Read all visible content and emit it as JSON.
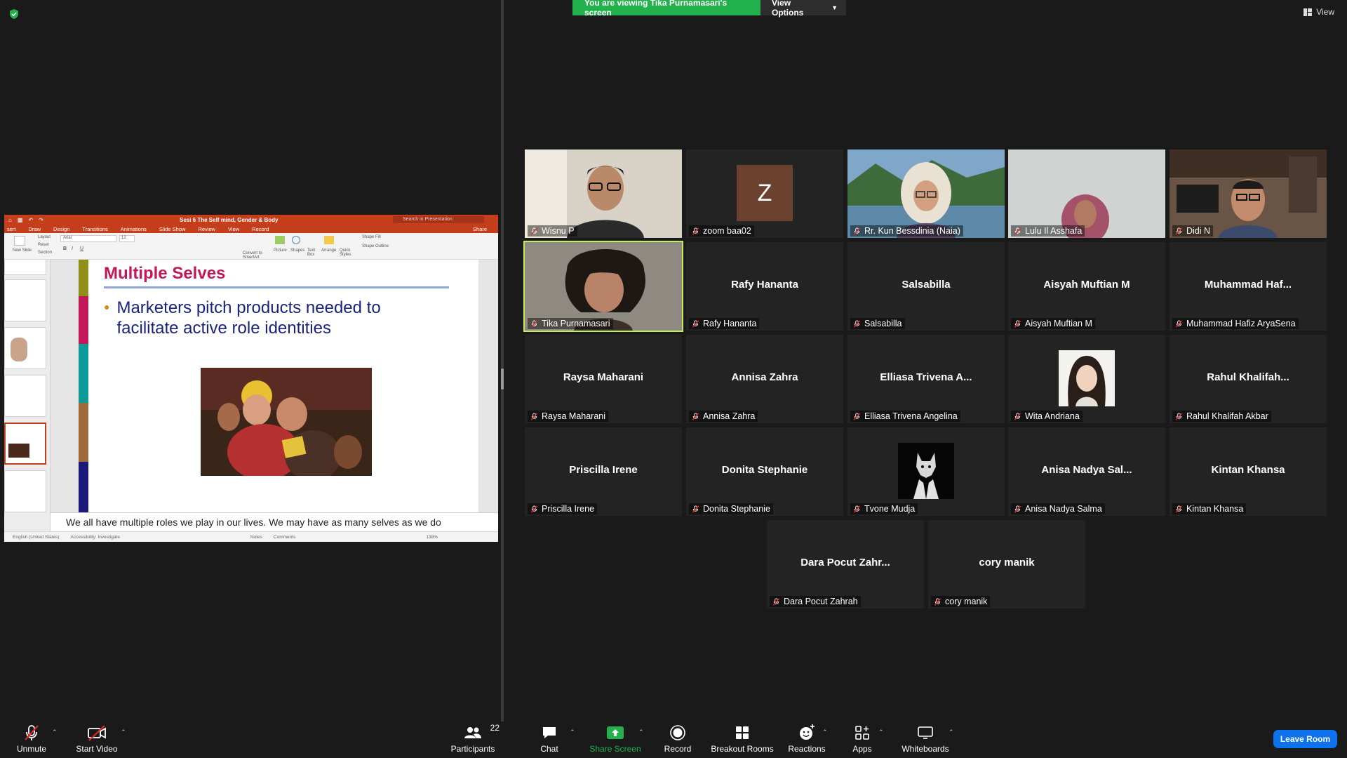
{
  "banner": {
    "viewing_text": "You are viewing Tika Purnamasari's screen",
    "view_options_label": "View Options"
  },
  "view_button_label": "View",
  "colors": {
    "banner_green": "#23b14d",
    "speaker_outline": "#c2ee5a",
    "leave_blue": "#0e72ed",
    "muted_red": "#e02828",
    "share_screen_green": "#23b14d",
    "powerpoint_red": "#c43e1c"
  },
  "presentation": {
    "doc_title": "Sesi 6 The Self mind, Gender & Body",
    "search_placeholder": "Search in Presentation",
    "tabs": [
      "sert",
      "Draw",
      "Design",
      "Transitions",
      "Animations",
      "Slide Show",
      "Review",
      "View",
      "Record"
    ],
    "share_label": "Share",
    "ribbon": {
      "new_slide": "New Slide",
      "layout": "Layout",
      "reset": "Reset",
      "section": "Section",
      "font": "Arial",
      "font_size": "12",
      "convert_smartart": "Convert to SmartArt",
      "picture": "Picture",
      "shapes": "Shapes",
      "text_box": "Text Box",
      "arrange": "Arrange",
      "quick_styles": "Quick Styles",
      "shape_fill": "Shape Fill",
      "shape_outline": "Shape Outline"
    },
    "slide": {
      "title": "Multiple Selves",
      "bullet": "Marketers pitch products needed to facilitate active role identities"
    },
    "notes_text": "We all have multiple roles we play in our lives. We may have as many selves as we do",
    "status": {
      "language": "English (United States)",
      "accessibility": "Accessibility: Investigate",
      "notes": "Notes",
      "comments": "Comments",
      "zoom": "138%"
    }
  },
  "participants": [
    {
      "name": "Wisnu P",
      "display": "",
      "type": "video"
    },
    {
      "name": "zoom baa02",
      "display": "",
      "type": "letter",
      "letter": "Z"
    },
    {
      "name": "Rr. Kun Bessdinia (Naia)",
      "display": "",
      "type": "video"
    },
    {
      "name": "Lulu Il Asshafa",
      "display": "",
      "type": "video"
    },
    {
      "name": "Didi N",
      "display": "",
      "type": "video"
    },
    {
      "name": "Tika Purnamasari",
      "display": "",
      "type": "video",
      "speaker": true
    },
    {
      "name": "Rafy Hananta",
      "display": "Rafy Hananta",
      "type": "name"
    },
    {
      "name": "Salsabilla",
      "display": "Salsabilla",
      "type": "name"
    },
    {
      "name": "Aisyah Muftian M",
      "display": "Aisyah Muftian M",
      "type": "name"
    },
    {
      "name": "Muhammad Hafiz AryaSena",
      "display": "Muhammad  Haf...",
      "type": "name"
    },
    {
      "name": "Raysa Maharani",
      "display": "Raysa Maharani",
      "type": "name"
    },
    {
      "name": "Annisa Zahra",
      "display": "Annisa Zahra",
      "type": "name"
    },
    {
      "name": "Elliasa Trivena Angelina",
      "display": "Elliasa  Trivena  A...",
      "type": "name"
    },
    {
      "name": "Wita Andriana",
      "display": "",
      "type": "photo"
    },
    {
      "name": "Rahul Khalifah Akbar",
      "display": "Rahul  Khalifah...",
      "type": "name"
    },
    {
      "name": "Priscilla Irene",
      "display": "Priscilla Irene",
      "type": "name"
    },
    {
      "name": "Donita Stephanie",
      "display": "Donita Stephanie",
      "type": "name"
    },
    {
      "name": "Tvone Mudja",
      "display": "",
      "type": "wolf"
    },
    {
      "name": "Anisa Nadya Salma",
      "display": "Anisa  Nadya  Sal...",
      "type": "name"
    },
    {
      "name": "Kintan Khansa",
      "display": "Kintan Khansa",
      "type": "name"
    },
    {
      "name": "Dara Pocut Zahrah",
      "display": "Dara  Pocut  Zahr...",
      "type": "name"
    },
    {
      "name": "cory manik",
      "display": "cory manik",
      "type": "name"
    }
  ],
  "toolbar": {
    "unmute": "Unmute",
    "start_video": "Start Video",
    "participants": "Participants",
    "participants_count": "22",
    "chat": "Chat",
    "share_screen": "Share Screen",
    "record": "Record",
    "breakout_rooms": "Breakout Rooms",
    "reactions": "Reactions",
    "apps": "Apps",
    "whiteboards": "Whiteboards",
    "leave_room": "Leave Room"
  }
}
